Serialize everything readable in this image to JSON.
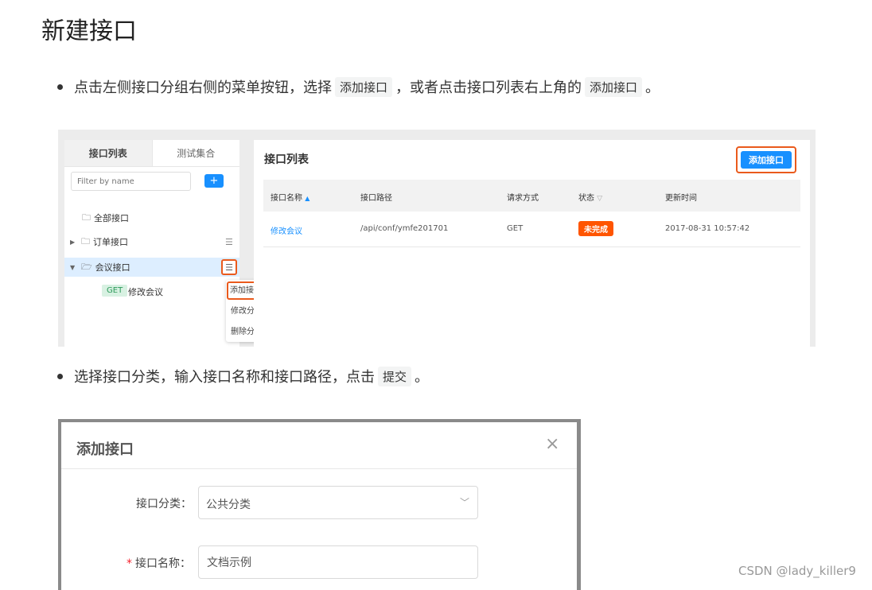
{
  "doc": {
    "title": "新建接口",
    "step1": {
      "text_a": "点击左侧接口分组右侧的菜单按钮，选择",
      "code_a": "添加接口",
      "text_b": "，或者点击接口列表右上角的",
      "code_b": "添加接口",
      "text_c": "。"
    },
    "step2": {
      "text_a": "选择接口分类，输入接口名称和接口路径，点击",
      "code_a": "提交",
      "text_b": "。"
    }
  },
  "shot1": {
    "side_tabs": [
      "接口列表",
      "测试集合"
    ],
    "filter_placeholder": "Filter by name",
    "add_symbol": "+",
    "tree": {
      "all": "全部接口",
      "order": "订单接口",
      "meeting": "会议接口",
      "method": "GET",
      "api_name": "修改会议"
    },
    "context_menu": [
      "添加接口",
      "修改分类",
      "删除分类"
    ],
    "main_title": "接口列表",
    "add_button": "添加接口",
    "columns": [
      "接口名称",
      "接口路径",
      "请求方式",
      "状态",
      "更新时间"
    ],
    "row": {
      "name": "修改会议",
      "path": "/api/conf/ymfe201701",
      "method": "GET",
      "status": "未完成",
      "updated": "2017-08-31 10:57:42"
    }
  },
  "shot2": {
    "modal_title": "添加接口",
    "close": "×",
    "category_label": "接口分类：",
    "category_value": "公共分类",
    "name_required": "*",
    "name_label": "接口名称：",
    "name_value": "文档示例"
  },
  "watermark": "CSDN @lady_killer9",
  "colors": {
    "primary": "#1890ff",
    "highlight": "#ea5a1c",
    "status": "#ff5500",
    "get": "#2d9a5a"
  }
}
